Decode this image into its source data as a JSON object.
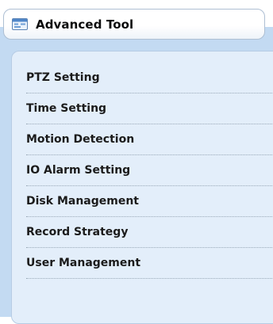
{
  "header": {
    "title": "Advanced Tool",
    "icon": "window-icon"
  },
  "menu": {
    "items": [
      {
        "label": "PTZ Setting"
      },
      {
        "label": "Time Setting"
      },
      {
        "label": "Motion Detection"
      },
      {
        "label": "IO Alarm Setting"
      },
      {
        "label": "Disk Management"
      },
      {
        "label": "Record Strategy"
      },
      {
        "label": "User Management"
      }
    ]
  },
  "colors": {
    "panel_background": "#c3daf2",
    "menu_background": "#e3eefa",
    "header_border": "#aebfd3",
    "text": "#1b1b1b"
  }
}
